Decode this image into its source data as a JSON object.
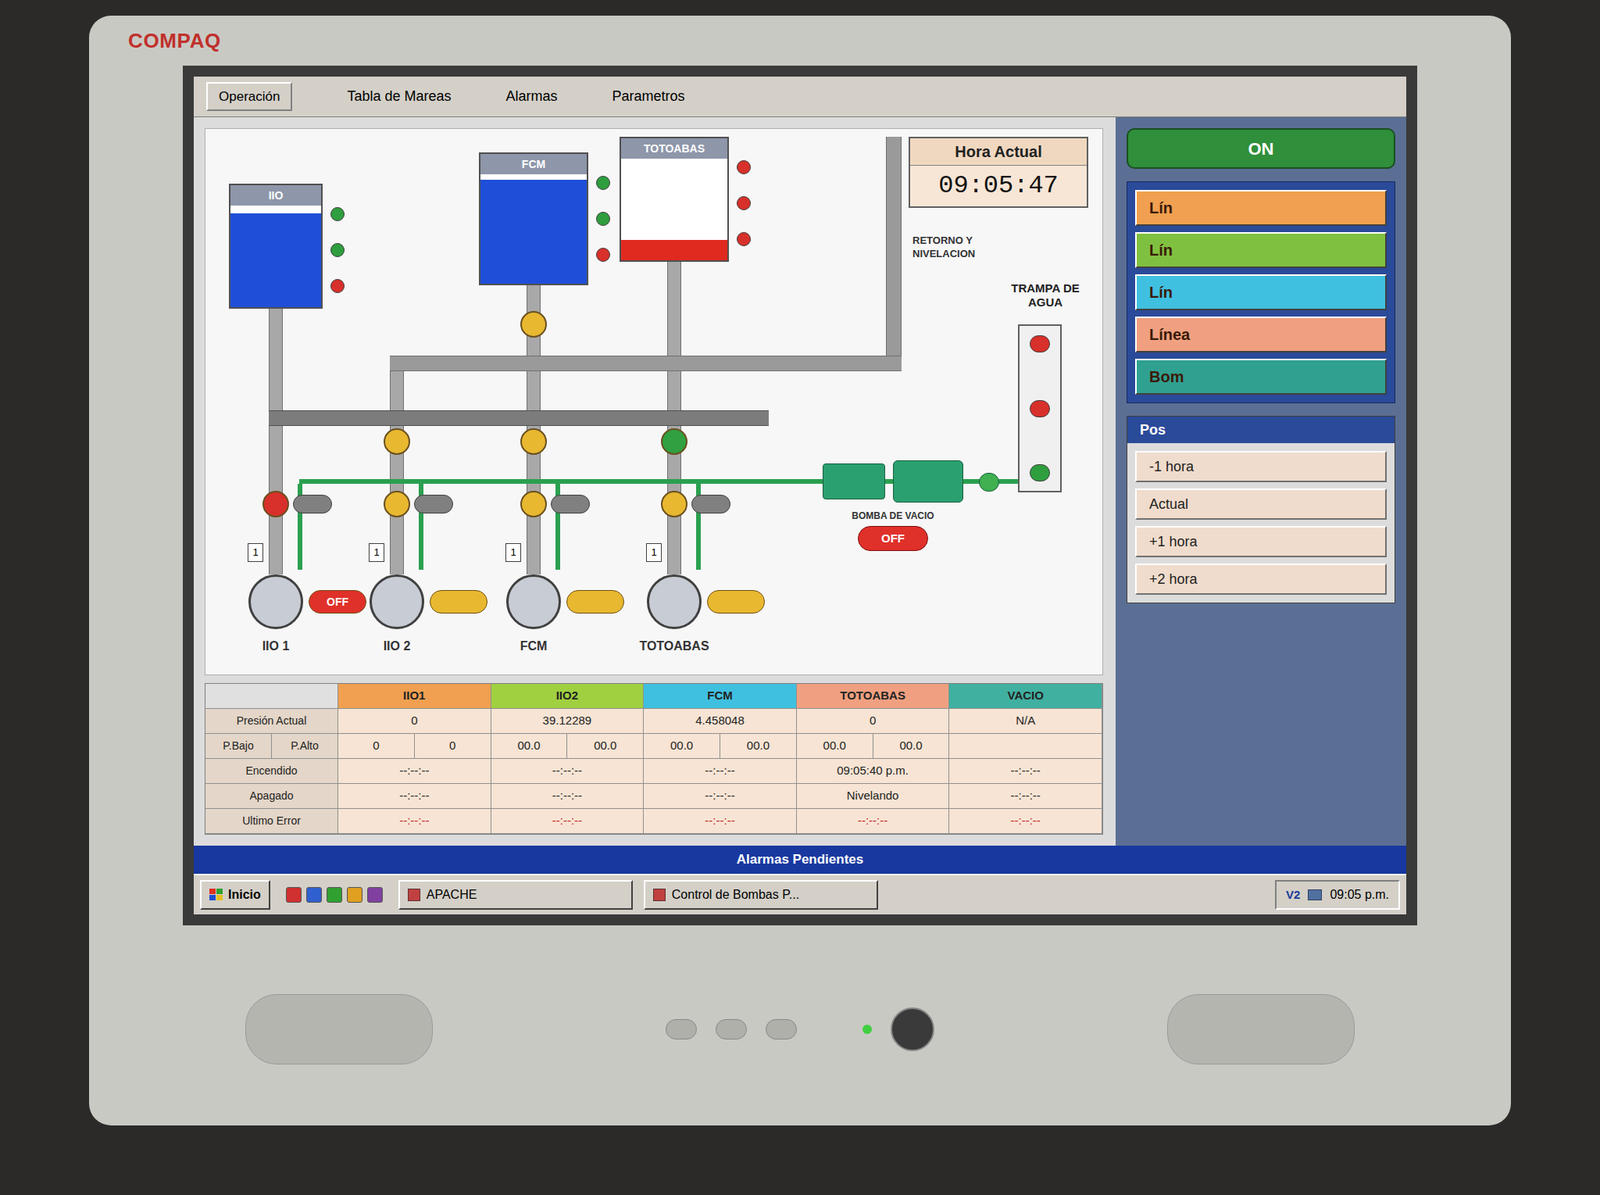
{
  "monitor": {
    "brand": "COMPAQ"
  },
  "menu": {
    "button": "Operación",
    "items": [
      "Tabla de Mareas",
      "Alarmas",
      "Parametros"
    ]
  },
  "clock": {
    "label": "Hora Actual",
    "time": "09:05:47"
  },
  "tanks": [
    {
      "label": "IIO",
      "level": 0.92,
      "color": "#1f4fd8",
      "lights": [
        "#2e9e3e",
        "#2e9e3e",
        "#d8302a"
      ]
    },
    {
      "label": "FCM",
      "level": 0.95,
      "color": "#1f4fd8",
      "lights": [
        "#2e9e3e",
        "#2e9e3e",
        "#d8302a"
      ]
    },
    {
      "label": "TOTOABAS",
      "level": 0.2,
      "color": "#e02a20",
      "lights": [
        "#d8302a",
        "#d8302a",
        "#d8302a"
      ]
    }
  ],
  "return_label": "RETORNO Y NIVELACION",
  "water_trap": {
    "label": "TRAMPA DE AGUA",
    "lights": [
      "#d8302a",
      "#d8302a",
      "#2e9e3e"
    ]
  },
  "valves": [
    {
      "color": "#e8b830"
    },
    {
      "color": "#e8b830"
    },
    {
      "color": "#e8b830"
    },
    {
      "color": "#30a040"
    },
    {
      "color": "#d8302a"
    },
    {
      "color": "#e8b830"
    },
    {
      "color": "#e8b830"
    },
    {
      "color": "#e8b830"
    }
  ],
  "vacuum_pump": {
    "label": "BOMBA DE VACIO",
    "status": "OFF",
    "color": "#e0302a"
  },
  "pumps": [
    {
      "label": "IIO 1",
      "number": "1",
      "status": "OFF",
      "color": "#e0302a"
    },
    {
      "label": "IIO 2",
      "number": "1",
      "color": "#e8b830"
    },
    {
      "label": "FCM",
      "number": "1",
      "color": "#e8b830"
    },
    {
      "label": "TOTOABAS",
      "number": "1",
      "color": "#e8b830"
    }
  ],
  "table": {
    "columns": [
      {
        "label": "IIO1",
        "color": "#f0a050"
      },
      {
        "label": "IIO2",
        "color": "#a0d040"
      },
      {
        "label": "FCM",
        "color": "#40c0e0"
      },
      {
        "label": "TOTOABAS",
        "color": "#f0a080"
      },
      {
        "label": "VACIO",
        "color": "#40b0a0"
      }
    ],
    "rows": [
      {
        "labels": [
          "Presión Actual"
        ],
        "alert": false,
        "cells": [
          [
            "0"
          ],
          [
            "39.12289"
          ],
          [
            "4.458048"
          ],
          [
            "0"
          ],
          [
            "N/A"
          ]
        ]
      },
      {
        "labels": [
          "P.Bajo",
          "P.Alto"
        ],
        "alert": false,
        "cells": [
          [
            "0",
            "0"
          ],
          [
            "00.0",
            "00.0"
          ],
          [
            "00.0",
            "00.0"
          ],
          [
            "00.0",
            "00.0"
          ],
          []
        ]
      },
      {
        "labels": [
          "Encendido"
        ],
        "alert": false,
        "cells": [
          [
            "--:--:--"
          ],
          [
            "--:--:--"
          ],
          [
            "--:--:--"
          ],
          [
            "09:05:40 p.m."
          ],
          [
            "--:--:--"
          ]
        ]
      },
      {
        "labels": [
          "Apagado"
        ],
        "alert": false,
        "cells": [
          [
            "--:--:--"
          ],
          [
            "--:--:--"
          ],
          [
            "--:--:--"
          ],
          [
            "Nivelando"
          ],
          [
            "--:--:--"
          ]
        ]
      },
      {
        "labels": [
          "Ultimo Error"
        ],
        "alert": true,
        "cells": [
          [
            "--:--:--"
          ],
          [
            "--:--:--"
          ],
          [
            "--:--:--"
          ],
          [
            "--:--:--"
          ],
          [
            "--:--:--"
          ]
        ]
      }
    ]
  },
  "right_panel": {
    "on_button": "ON",
    "lines": [
      {
        "label": "Lín",
        "color": "#f0a050"
      },
      {
        "label": "Lín",
        "color": "#80c040"
      },
      {
        "label": "Lín",
        "color": "#40c0e0"
      },
      {
        "label": "Línea",
        "color": "#f0a080"
      },
      {
        "label": "Bom",
        "color": "#30a090"
      }
    ],
    "pos": {
      "title": "Pos",
      "buttons": [
        "-1 hora",
        "Actual",
        "+1 hora",
        "+2 hora"
      ]
    }
  },
  "alarm_bar": "Alarmas Pendientes",
  "taskbar": {
    "start": "Inicio",
    "tasks": [
      "APACHE",
      "Control de Bombas P..."
    ],
    "tray": "V2",
    "clock": "09:05 p.m."
  }
}
